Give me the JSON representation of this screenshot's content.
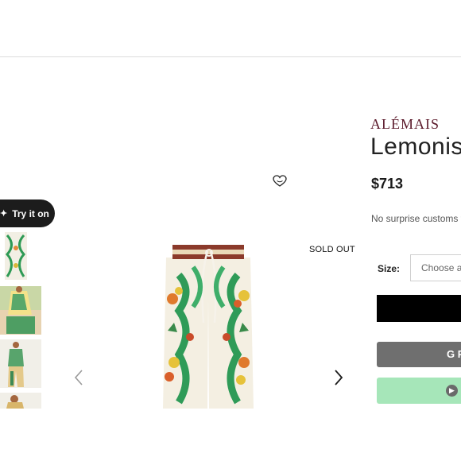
{
  "try_on": {
    "label": "Try it on"
  },
  "product_gallery": {
    "sold_out_badge": "SOLD OUT",
    "thumbnail_count": 4
  },
  "product": {
    "brand": "ALÉMAIS",
    "title": "Lemonis",
    "price": "$713",
    "customs_note": "No surprise customs fe"
  },
  "size": {
    "label": "Size:",
    "placeholder": "Choose ar"
  },
  "buttons": {
    "google_pay_text": "G P"
  },
  "colors": {
    "brand": "#5b1a2b",
    "add_button": "#000000",
    "google_pay": "#6f6f6f",
    "alt_pay": "#a6e6b9"
  }
}
